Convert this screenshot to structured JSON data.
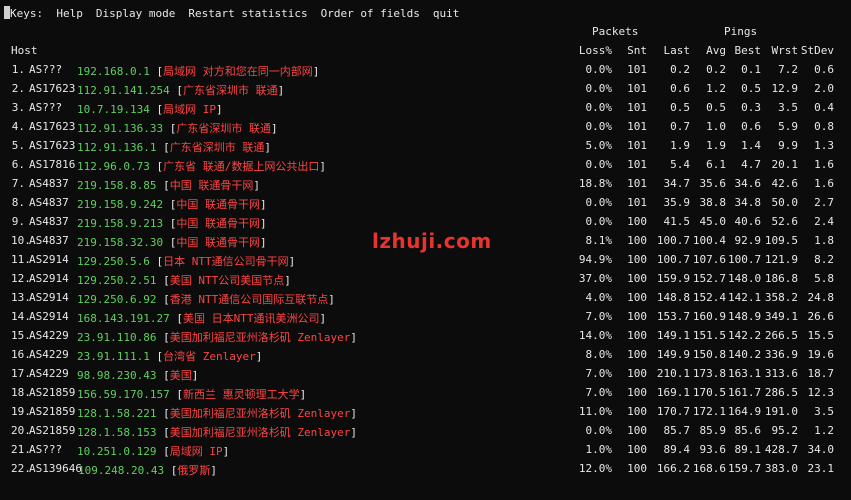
{
  "keys": {
    "label": "Keys:",
    "items": [
      "Help",
      "Display mode",
      "Restart statistics",
      "Order of fields",
      "quit"
    ]
  },
  "headers": {
    "group_packets": "Packets",
    "group_pings": "Pings",
    "host": "Host",
    "loss": "Loss%",
    "snt": "Snt",
    "last": "Last",
    "avg": "Avg",
    "best": "Best",
    "wrst": "Wrst",
    "stdev": "StDev"
  },
  "hops": [
    {
      "num": "1.",
      "asn": "AS???",
      "ip": "192.168.0.1",
      "loc": "局域网 对方和您在同一内部网",
      "loss": "0.0%",
      "snt": "101",
      "last": "0.2",
      "avg": "0.2",
      "best": "0.1",
      "wrst": "7.2",
      "stdev": "0.6"
    },
    {
      "num": "2.",
      "asn": "AS17623",
      "ip": "112.91.141.254",
      "loc": "广东省深圳市 联通",
      "loss": "0.0%",
      "snt": "101",
      "last": "0.6",
      "avg": "1.2",
      "best": "0.5",
      "wrst": "12.9",
      "stdev": "2.0"
    },
    {
      "num": "3.",
      "asn": "AS???",
      "ip": "10.7.19.134",
      "loc": "局域网 IP",
      "loss": "0.0%",
      "snt": "101",
      "last": "0.5",
      "avg": "0.5",
      "best": "0.3",
      "wrst": "3.5",
      "stdev": "0.4"
    },
    {
      "num": "4.",
      "asn": "AS17623",
      "ip": "112.91.136.33",
      "loc": "广东省深圳市 联通",
      "loss": "0.0%",
      "snt": "101",
      "last": "0.7",
      "avg": "1.0",
      "best": "0.6",
      "wrst": "5.9",
      "stdev": "0.8"
    },
    {
      "num": "5.",
      "asn": "AS17623",
      "ip": "112.91.136.1",
      "loc": "广东省深圳市 联通",
      "loss": "5.0%",
      "snt": "101",
      "last": "1.9",
      "avg": "1.9",
      "best": "1.4",
      "wrst": "9.9",
      "stdev": "1.3"
    },
    {
      "num": "6.",
      "asn": "AS17816",
      "ip": "112.96.0.73",
      "loc": "广东省 联通/数据上网公共出口",
      "loss": "0.0%",
      "snt": "101",
      "last": "5.4",
      "avg": "6.1",
      "best": "4.7",
      "wrst": "20.1",
      "stdev": "1.6"
    },
    {
      "num": "7.",
      "asn": "AS4837",
      "ip": "219.158.8.85",
      "loc": "中国 联通骨干网",
      "loss": "18.8%",
      "snt": "101",
      "last": "34.7",
      "avg": "35.6",
      "best": "34.6",
      "wrst": "42.6",
      "stdev": "1.6"
    },
    {
      "num": "8.",
      "asn": "AS4837",
      "ip": "219.158.9.242",
      "loc": "中国 联通骨干网",
      "loss": "0.0%",
      "snt": "101",
      "last": "35.9",
      "avg": "38.8",
      "best": "34.8",
      "wrst": "50.0",
      "stdev": "2.7"
    },
    {
      "num": "9.",
      "asn": "AS4837",
      "ip": "219.158.9.213",
      "loc": "中国 联通骨干网",
      "loss": "0.0%",
      "snt": "100",
      "last": "41.5",
      "avg": "45.0",
      "best": "40.6",
      "wrst": "52.6",
      "stdev": "2.4"
    },
    {
      "num": "10.",
      "asn": "AS4837",
      "ip": "219.158.32.30",
      "loc": "中国 联通骨干网",
      "loss": "8.1%",
      "snt": "100",
      "last": "100.7",
      "avg": "100.4",
      "best": "92.9",
      "wrst": "109.5",
      "stdev": "1.8"
    },
    {
      "num": "11.",
      "asn": "AS2914",
      "ip": "129.250.5.6",
      "loc": "日本 NTT通信公司骨干网",
      "loss": "94.9%",
      "snt": "100",
      "last": "100.7",
      "avg": "107.6",
      "best": "100.7",
      "wrst": "121.9",
      "stdev": "8.2"
    },
    {
      "num": "12.",
      "asn": "AS2914",
      "ip": "129.250.2.51",
      "loc": "美国 NTT公司美国节点",
      "loss": "37.0%",
      "snt": "100",
      "last": "159.9",
      "avg": "152.7",
      "best": "148.0",
      "wrst": "186.8",
      "stdev": "5.8"
    },
    {
      "num": "13.",
      "asn": "AS2914",
      "ip": "129.250.6.92",
      "loc": "香港 NTT通信公司国际互联节点",
      "loss": "4.0%",
      "snt": "100",
      "last": "148.8",
      "avg": "152.4",
      "best": "142.1",
      "wrst": "358.2",
      "stdev": "24.8"
    },
    {
      "num": "14.",
      "asn": "AS2914",
      "ip": "168.143.191.27",
      "loc": "美国 日本NTT通讯美洲公司",
      "loss": "7.0%",
      "snt": "100",
      "last": "153.7",
      "avg": "160.9",
      "best": "148.9",
      "wrst": "349.1",
      "stdev": "26.6"
    },
    {
      "num": "15.",
      "asn": "AS4229",
      "ip": "23.91.110.86",
      "loc": "美国加利福尼亚州洛杉矶 Zenlayer",
      "loss": "14.0%",
      "snt": "100",
      "last": "149.1",
      "avg": "151.5",
      "best": "142.2",
      "wrst": "266.5",
      "stdev": "15.5"
    },
    {
      "num": "16.",
      "asn": "AS4229",
      "ip": "23.91.111.1",
      "loc": "台湾省 Zenlayer",
      "loss": "8.0%",
      "snt": "100",
      "last": "149.9",
      "avg": "150.8",
      "best": "140.2",
      "wrst": "336.9",
      "stdev": "19.6"
    },
    {
      "num": "17.",
      "asn": "AS4229",
      "ip": "98.98.230.43",
      "loc": "美国",
      "loss": "7.0%",
      "snt": "100",
      "last": "210.1",
      "avg": "173.8",
      "best": "163.1",
      "wrst": "313.6",
      "stdev": "18.7"
    },
    {
      "num": "18.",
      "asn": "AS21859",
      "ip": "156.59.170.157",
      "loc": "新西兰 惠灵顿理工大学",
      "loss": "7.0%",
      "snt": "100",
      "last": "169.1",
      "avg": "170.5",
      "best": "161.7",
      "wrst": "286.5",
      "stdev": "12.3"
    },
    {
      "num": "19.",
      "asn": "AS21859",
      "ip": "128.1.58.221",
      "loc": "美国加利福尼亚州洛杉矶 Zenlayer",
      "loss": "11.0%",
      "snt": "100",
      "last": "170.7",
      "avg": "172.1",
      "best": "164.9",
      "wrst": "191.0",
      "stdev": "3.5"
    },
    {
      "num": "20.",
      "asn": "AS21859",
      "ip": "128.1.58.153",
      "loc": "美国加利福尼亚州洛杉矶 Zenlayer",
      "loss": "0.0%",
      "snt": "100",
      "last": "85.7",
      "avg": "85.9",
      "best": "85.6",
      "wrst": "95.2",
      "stdev": "1.2"
    },
    {
      "num": "21.",
      "asn": "AS???",
      "ip": "10.251.0.129",
      "loc": "局域网 IP",
      "loss": "1.0%",
      "snt": "100",
      "last": "89.4",
      "avg": "93.6",
      "best": "89.1",
      "wrst": "428.7",
      "stdev": "34.0"
    },
    {
      "num": "22.",
      "asn": "AS139646",
      "ip": "109.248.20.43",
      "loc": "俄罗斯",
      "loss": "12.0%",
      "snt": "100",
      "last": "166.2",
      "avg": "168.6",
      "best": "159.7",
      "wrst": "383.0",
      "stdev": "23.1"
    }
  ],
  "watermark": "lzhuji.com",
  "colors": {
    "background": "#0c0c0c",
    "ip_green": "#5fd05f",
    "location_red": "#ff4444",
    "watermark_red": "#e8342e"
  }
}
